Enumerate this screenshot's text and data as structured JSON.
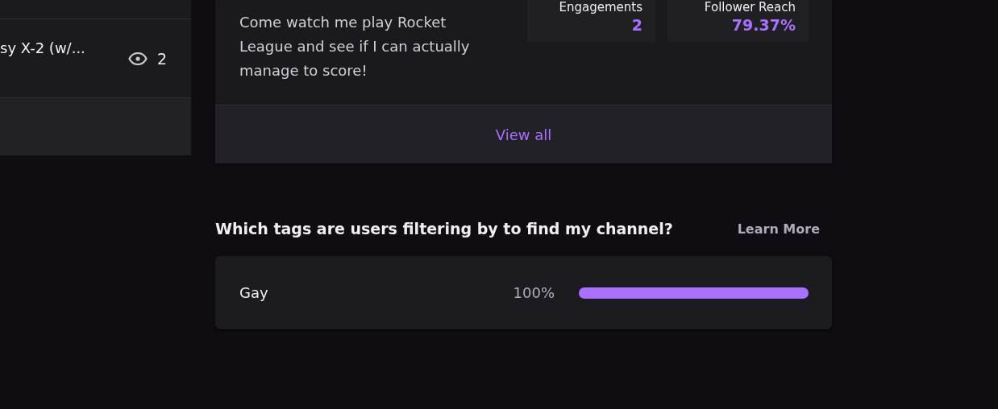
{
  "recent_videos": {
    "rows": [
      {
        "title": "sy X-2 (w/...",
        "views": "2"
      }
    ]
  },
  "stream_card": {
    "description": "Come watch me play Rocket League and see if I can actually manage to score!",
    "stats": [
      {
        "label": "Engagements",
        "value": "2"
      },
      {
        "label": "Follower Reach",
        "value": "79.37%"
      }
    ],
    "view_all": "View all"
  },
  "tags_section": {
    "title": "Which tags are users filtering by to find my channel?",
    "learn_more": "Learn More",
    "tags": [
      {
        "name": "Gay",
        "percent": "100%",
        "level": 1
      }
    ]
  }
}
